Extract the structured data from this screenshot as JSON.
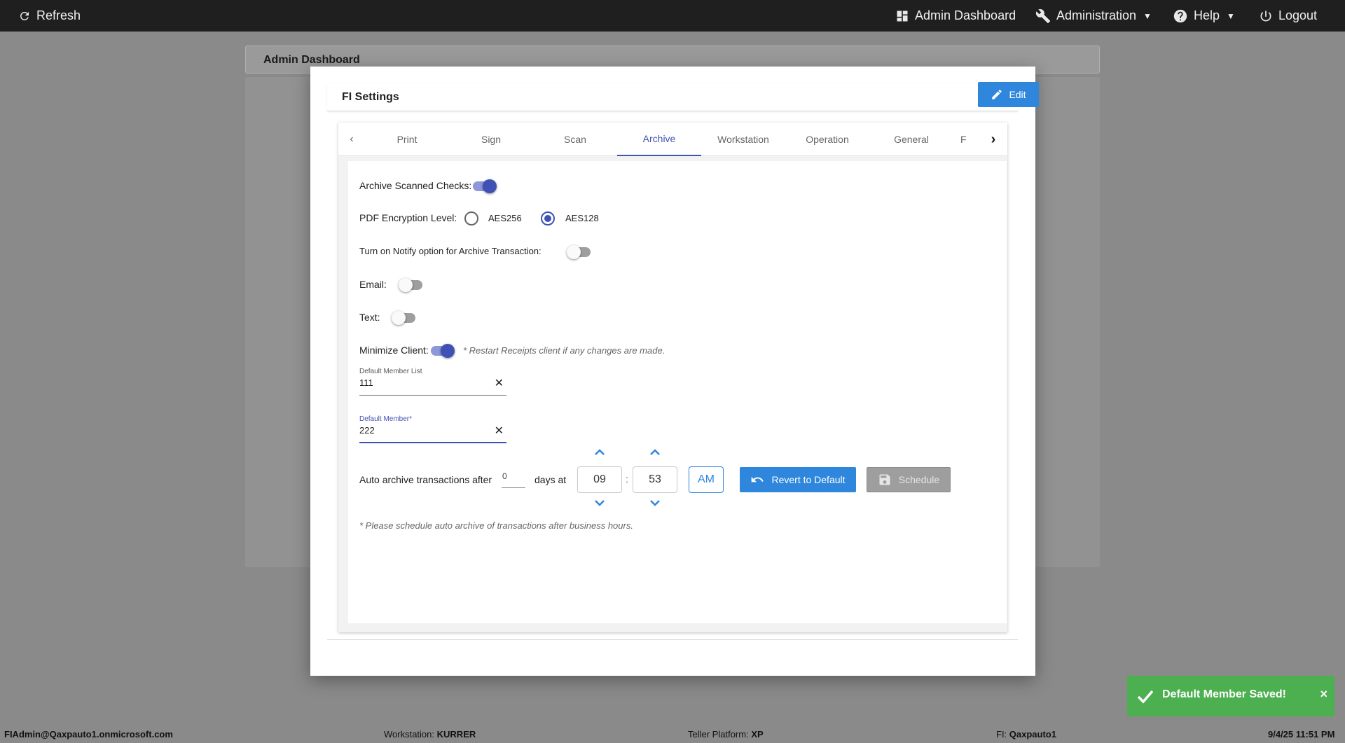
{
  "topbar": {
    "refresh": "Refresh",
    "admin_dashboard": "Admin Dashboard",
    "administration": "Administration",
    "help": "Help",
    "logout": "Logout"
  },
  "background": {
    "header_title": "Admin Dashboard"
  },
  "modal": {
    "title": "FI Settings",
    "edit_label": "Edit",
    "tabs": [
      "Print",
      "Sign",
      "Scan",
      "Archive",
      "Workstation",
      "Operation",
      "General",
      "F"
    ],
    "active_tab": "Archive"
  },
  "archive": {
    "archive_scanned_checks_label": "Archive Scanned Checks:",
    "archive_scanned_checks_on": true,
    "pdf_encryption_label": "PDF Encryption Level:",
    "pdf_options": [
      "AES256",
      "AES128"
    ],
    "pdf_selected": "AES128",
    "notify_label": "Turn on Notify option for Archive Transaction:",
    "notify_on": false,
    "email_label": "Email:",
    "email_on": false,
    "text_label": "Text:",
    "text_on": false,
    "minimize_label": "Minimize Client:",
    "minimize_on": true,
    "minimize_note": "* Restart Receipts client if any changes are made.",
    "default_member_list_label": "Default Member List",
    "default_member_list_value": "111",
    "default_member_label": "Default Member*",
    "default_member_value": "222",
    "auto_archive_label": "Auto archive transactions after",
    "days_value": "0",
    "days_at_label": "days at",
    "hour": "09",
    "minute": "53",
    "time_separator": ":",
    "ampm": "AM",
    "revert_label": "Revert to Default",
    "schedule_label": "Schedule",
    "schedule_note": "* Please schedule auto archive of transactions after business hours."
  },
  "toast": {
    "message": "Default Member Saved!",
    "close": "×"
  },
  "statusbar": {
    "user": "FIAdmin@Qaxpauto1.onmicrosoft.com",
    "workstation_label": "Workstation:",
    "workstation_value": "KURRER",
    "teller_label": "Teller Platform:",
    "teller_value": "XP",
    "fi_label": "FI:",
    "fi_value": "Qaxpauto1",
    "datetime": "9/4/25 11:51 PM"
  },
  "colors": {
    "accent": "#3f51b5",
    "button_blue": "#2f86dd",
    "toast_green": "#4caf50",
    "topbar": "#1f1f1f"
  }
}
